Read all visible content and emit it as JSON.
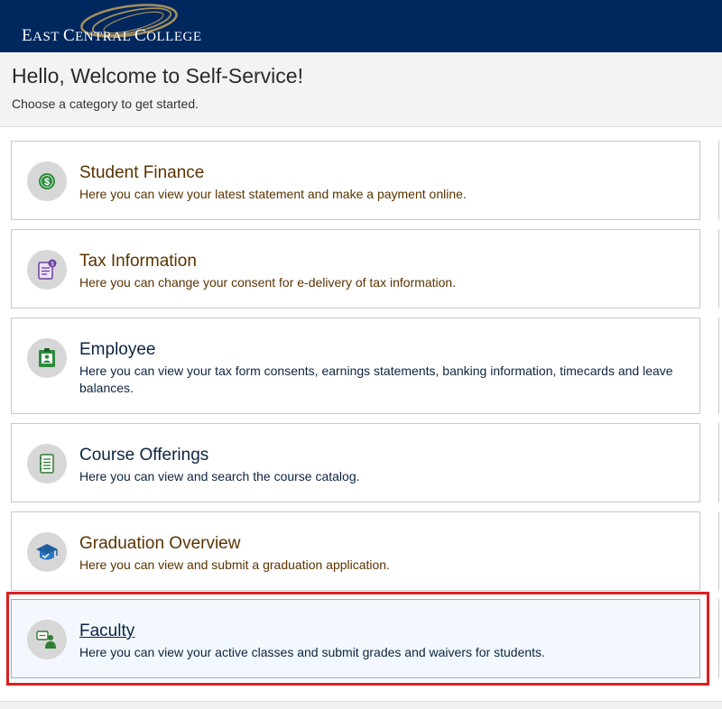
{
  "header": {
    "brand": "East Central College",
    "brand_parts": [
      {
        "cap": "E",
        "rest": "AST "
      },
      {
        "cap": "C",
        "rest": "ENTRAL "
      },
      {
        "cap": "C",
        "rest": "OLLEGE"
      }
    ]
  },
  "welcome": {
    "title": "Hello, Welcome to Self-Service!",
    "subtitle": "Choose a category to get started."
  },
  "categories": [
    {
      "title": "Student Finance",
      "description": "Here you can view your latest statement and make a payment online.",
      "icon": "dollar-icon"
    },
    {
      "title": "Tax Information",
      "description": "Here you can change your consent for e-delivery of tax information.",
      "icon": "tax-document-icon"
    },
    {
      "title": "Employee",
      "description": "Here you can view your tax form consents, earnings statements, banking information, timecards and leave balances.",
      "icon": "id-badge-icon"
    },
    {
      "title": "Course Offerings",
      "description": "Here you can view and search the course catalog.",
      "icon": "notebook-icon"
    },
    {
      "title": "Graduation Overview",
      "description": "Here you can view and submit a graduation application.",
      "icon": "graduation-cap-icon"
    },
    {
      "title": "Faculty",
      "description": "Here you can view your active classes and submit grades and waivers for students.",
      "icon": "teacher-icon"
    }
  ],
  "colors": {
    "header_bg": "#00285f",
    "title_brown": "#5a3300",
    "title_navy": "#0d2440",
    "highlight_red": "#dd1e1e"
  }
}
